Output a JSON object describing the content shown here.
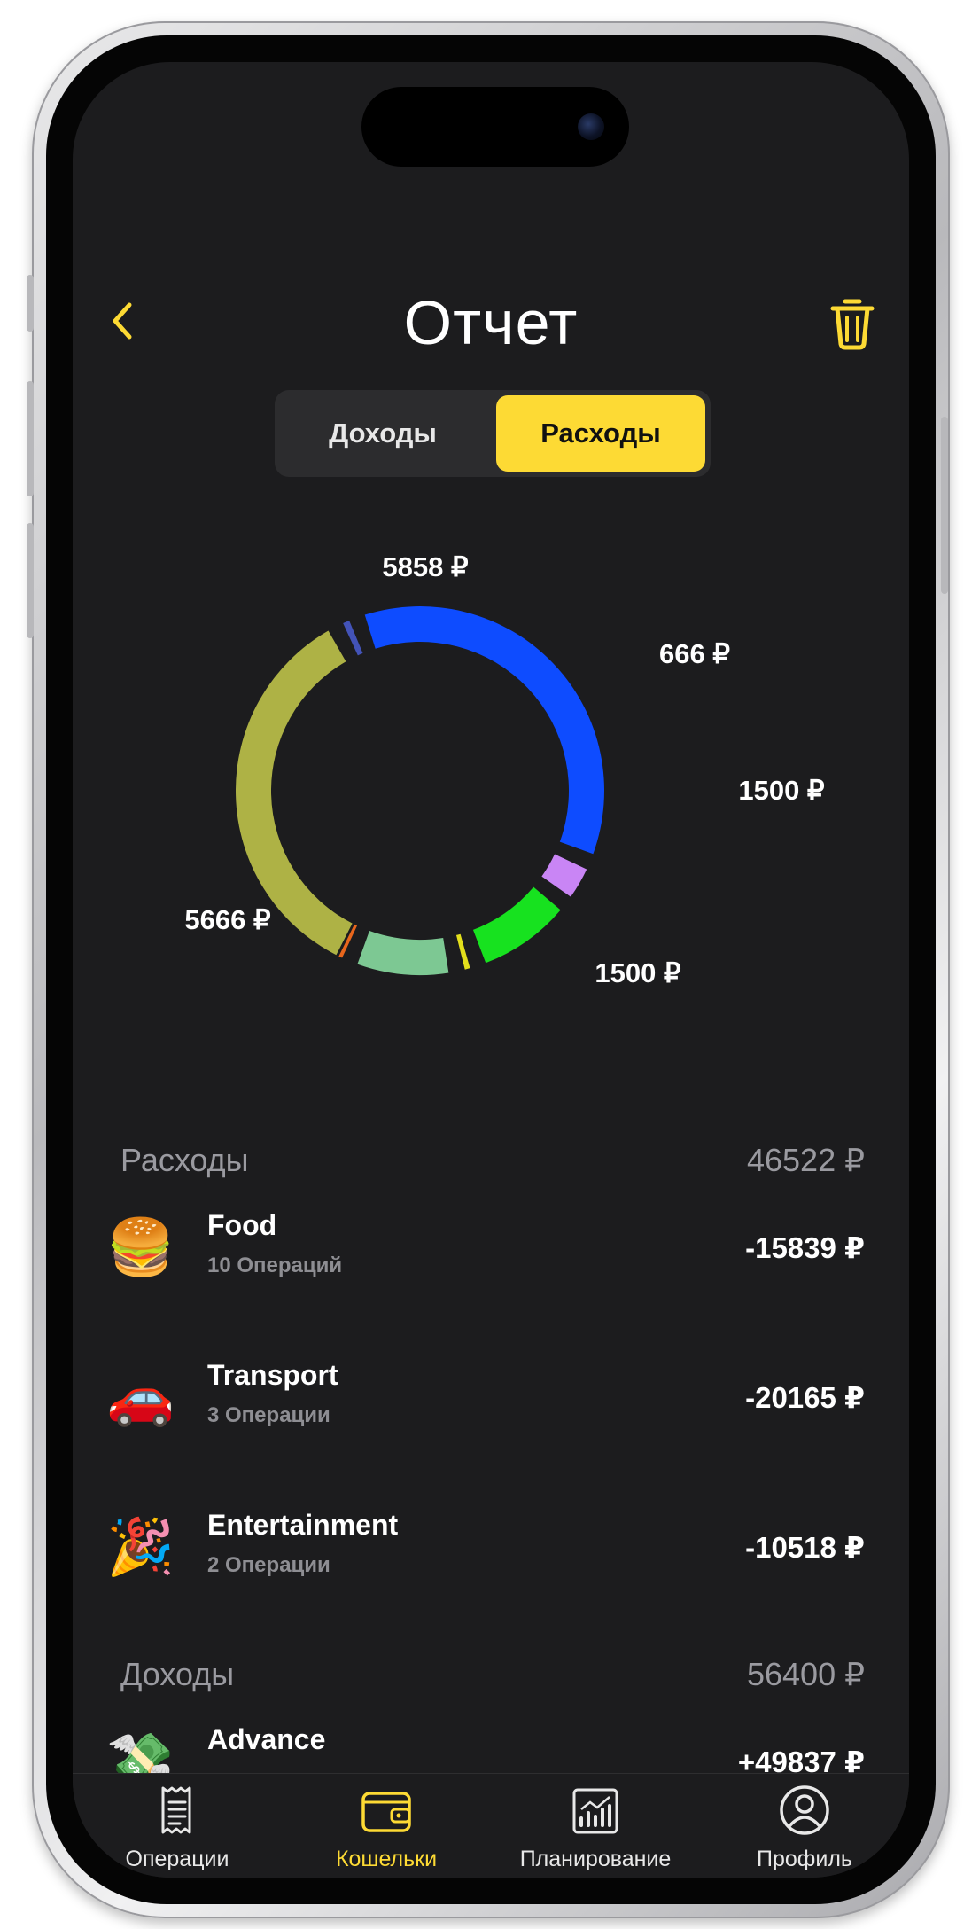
{
  "header": {
    "title": "Отчет",
    "back_icon": "chevron-left-icon",
    "trash_icon": "trash-icon",
    "accent_color": "#fdda34"
  },
  "segmented": {
    "income_label": "Доходы",
    "expense_label": "Расходы",
    "selected": "Расходы"
  },
  "chart_data": {
    "type": "pie",
    "style": "donut",
    "labels": [
      "5858 ₽",
      "666 ₽",
      "1500 ₽",
      "1500 ₽",
      "5666 ₽"
    ],
    "segments": [
      {
        "label": "5858 ₽",
        "value": 5858,
        "color": "#0e4cff"
      },
      {
        "label": "666 ₽",
        "value": 666,
        "color": "#c985f5"
      },
      {
        "label": "1500 ₽",
        "value": 1500,
        "color": "#17e21f"
      },
      {
        "label": "",
        "value": 300,
        "color": "#e3df1c"
      },
      {
        "label": "1500 ₽",
        "value": 1500,
        "color": "#7dc893"
      },
      {
        "label": "",
        "value": 90,
        "color": "#e8661c"
      },
      {
        "label": "5666 ₽",
        "value": 5666,
        "color": "#aeb245"
      },
      {
        "label": "",
        "value": 320,
        "color": "#4353b8"
      }
    ]
  },
  "expenses": {
    "title": "Расходы",
    "total": "46522 ₽",
    "items": [
      {
        "emoji": "🍔",
        "name": "Food",
        "count": "10 Операций",
        "amount": "-15839 ₽"
      },
      {
        "emoji": "🚗",
        "name": "Transport",
        "count": "3 Операции",
        "amount": "-20165 ₽"
      },
      {
        "emoji": "🎉",
        "name": "Entertainment",
        "count": "2 Операции",
        "amount": "-10518 ₽"
      }
    ]
  },
  "income": {
    "title": "Доходы",
    "total": "56400 ₽",
    "items": [
      {
        "emoji": "💸",
        "name": "Advance",
        "amount": "+49837 ₽"
      }
    ]
  },
  "tabbar": {
    "items": [
      {
        "label": "Операции",
        "icon": "receipt-icon"
      },
      {
        "label": "Кошельки",
        "icon": "wallet-icon"
      },
      {
        "label": "Планирование",
        "icon": "chart-board-icon"
      },
      {
        "label": "Профиль",
        "icon": "profile-icon"
      }
    ],
    "active": "Кошельки"
  }
}
